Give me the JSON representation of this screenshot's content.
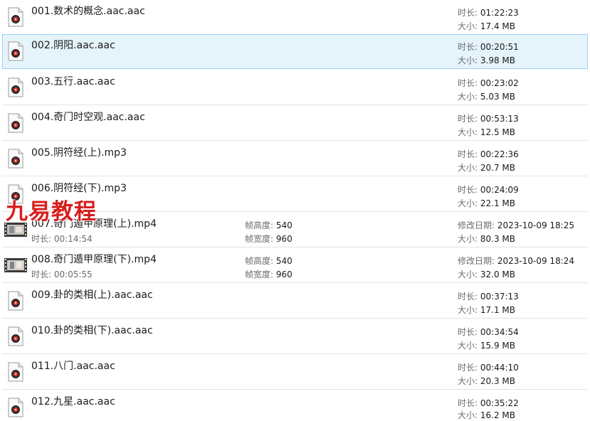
{
  "labels": {
    "duration": "时长:",
    "size": "大小:",
    "frame_height": "帧高度:",
    "frame_width": "帧宽度:",
    "modified": "修改日期:"
  },
  "watermark": "九易教程",
  "files": [
    {
      "name": "001.数术的概念.aac.aac",
      "duration": "01:22:23",
      "size": "17.4 MB"
    },
    {
      "name": "002.阴阳.aac.aac",
      "duration": "00:20:51",
      "size": "3.98 MB"
    },
    {
      "name": "003.五行.aac.aac",
      "duration": "00:23:02",
      "size": "5.03 MB"
    },
    {
      "name": "004.奇门时空观.aac.aac",
      "duration": "00:53:13",
      "size": "12.5 MB"
    },
    {
      "name": "005.阴符经(上).mp3",
      "duration": "00:22:36",
      "size": "20.7 MB"
    },
    {
      "name": "006.阴符经(下).mp3",
      "duration": "00:24:09",
      "size": "22.1 MB"
    },
    {
      "name": "007.奇门遁甲原理(上).mp4",
      "duration": "00:14:54",
      "frame_height": "540",
      "frame_width": "960",
      "modified": "2023-10-09 18:25",
      "size": "80.3 MB"
    },
    {
      "name": "008.奇门遁甲原理(下).mp4",
      "duration": "00:05:55",
      "frame_height": "540",
      "frame_width": "960",
      "modified": "2023-10-09 18:24",
      "size": "32.0 MB"
    },
    {
      "name": "009.卦的类相(上).aac.aac",
      "duration": "00:37:13",
      "size": "17.1 MB"
    },
    {
      "name": "010.卦的类相(下).aac.aac",
      "duration": "00:34:54",
      "size": "15.9 MB"
    },
    {
      "name": "011.八门.aac.aac",
      "duration": "00:44:10",
      "size": "20.3 MB"
    },
    {
      "name": "012.九星.aac.aac",
      "duration": "00:35:22",
      "size": "16.2 MB"
    }
  ],
  "icons": {
    "audio": "audio-file-icon",
    "video": "video-file-icon"
  },
  "colors": {
    "selected_bg": "#e5f3fb",
    "selected_border": "#99d1ef",
    "watermark": "#d81e1e"
  }
}
